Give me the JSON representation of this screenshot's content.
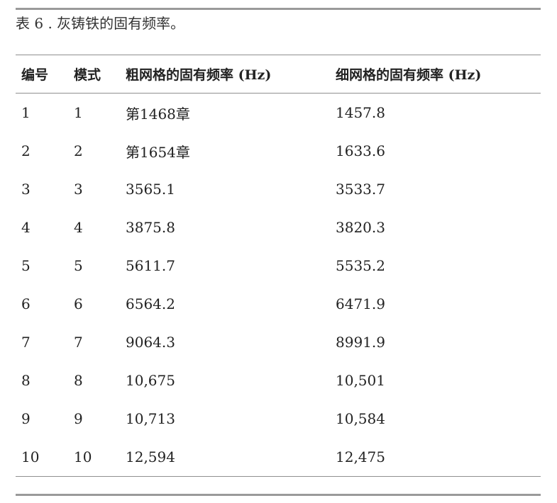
{
  "caption": "表 6 . 灰铸铁的固有频率。",
  "table": {
    "headers": [
      "编号",
      "模式",
      "粗网格的固有频率 (Hz)",
      "细网格的固有频率 (Hz)"
    ],
    "rows": [
      [
        "1",
        "1",
        "第1468章",
        "1457.8"
      ],
      [
        "2",
        "2",
        "第1654章",
        "1633.6"
      ],
      [
        "3",
        "3",
        "3565.1",
        "3533.7"
      ],
      [
        "4",
        "4",
        "3875.8",
        "3820.3"
      ],
      [
        "5",
        "5",
        "5611.7",
        "5535.2"
      ],
      [
        "6",
        "6",
        "6564.2",
        "6471.9"
      ],
      [
        "7",
        "7",
        "9064.3",
        "8991.9"
      ],
      [
        "8",
        "8",
        "10,675",
        "10,501"
      ],
      [
        "9",
        "9",
        "10,713",
        "10,584"
      ],
      [
        "10",
        "10",
        "12,594",
        "12,475"
      ]
    ]
  }
}
